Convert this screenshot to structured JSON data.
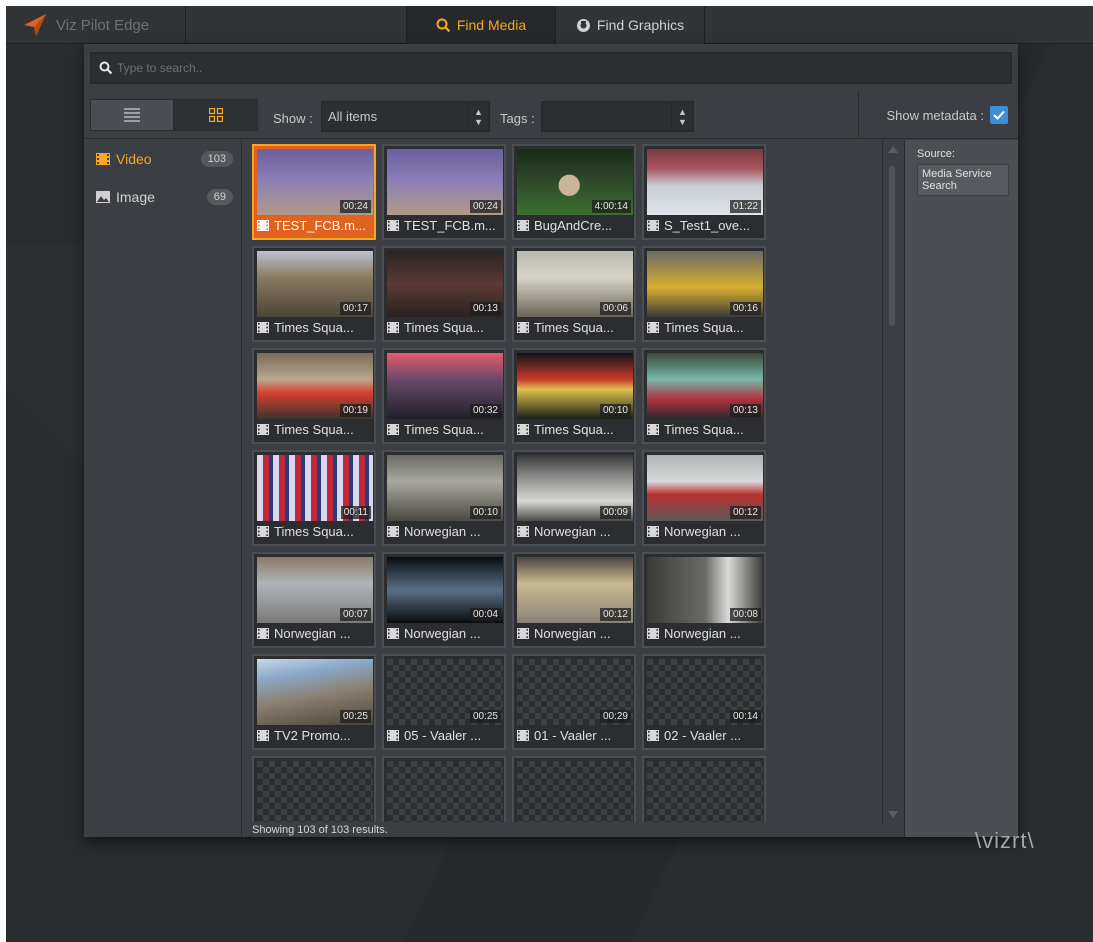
{
  "app": {
    "brand_name": "Viz Pilot Edge"
  },
  "tabs": [
    {
      "label": "Find Media",
      "active": true
    },
    {
      "label": "Find Graphics",
      "active": false
    }
  ],
  "search": {
    "placeholder": "Type to search.."
  },
  "toolbar": {
    "show_label": "Show :",
    "show_value": "All items",
    "tags_label": "Tags :",
    "tags_value": "",
    "show_metadata_label": "Show metadata :",
    "show_metadata_checked": true
  },
  "categories": [
    {
      "label": "Video",
      "count": "103",
      "active": true,
      "icon": "film-icon"
    },
    {
      "label": "Image",
      "count": "69",
      "active": false,
      "icon": "image-icon"
    }
  ],
  "items": [
    {
      "title": "TEST_FCB.m...",
      "duration": "00:24",
      "selected": true
    },
    {
      "title": "TEST_FCB.m...",
      "duration": "00:24"
    },
    {
      "title": "BugAndCre...",
      "duration": "4:00:14"
    },
    {
      "title": "S_Test1_ove...",
      "duration": "01:22"
    },
    {
      "title": "Times Squa...",
      "duration": "00:17"
    },
    {
      "title": "Times Squa...",
      "duration": "00:13"
    },
    {
      "title": "Times Squa...",
      "duration": "00:06"
    },
    {
      "title": "Times Squa...",
      "duration": "00:16"
    },
    {
      "title": "Times Squa...",
      "duration": "00:19"
    },
    {
      "title": "Times Squa...",
      "duration": "00:32"
    },
    {
      "title": "Times Squa...",
      "duration": "00:10"
    },
    {
      "title": "Times Squa...",
      "duration": "00:13"
    },
    {
      "title": "Times Squa...",
      "duration": "00:11"
    },
    {
      "title": "Norwegian ...",
      "duration": "00:10"
    },
    {
      "title": "Norwegian ...",
      "duration": "00:09"
    },
    {
      "title": "Norwegian ...",
      "duration": "00:12"
    },
    {
      "title": "Norwegian ...",
      "duration": "00:07"
    },
    {
      "title": "Norwegian ...",
      "duration": "00:04"
    },
    {
      "title": "Norwegian ...",
      "duration": "00:12"
    },
    {
      "title": "Norwegian ...",
      "duration": "00:08"
    },
    {
      "title": "TV2 Promo...",
      "duration": "00:25"
    },
    {
      "title": "05 - Vaaler ...",
      "duration": "00:25",
      "placeholder": true
    },
    {
      "title": "01 - Vaaler ...",
      "duration": "00:29",
      "placeholder": true
    },
    {
      "title": "02 - Vaaler ...",
      "duration": "00:14",
      "placeholder": true
    },
    {
      "title": "",
      "duration": "",
      "placeholder": true
    },
    {
      "title": "",
      "duration": "",
      "placeholder": true
    },
    {
      "title": "",
      "duration": "",
      "placeholder": true
    },
    {
      "title": "",
      "duration": "",
      "placeholder": true
    }
  ],
  "status": "Showing 103 of 103 results.",
  "source": {
    "label": "Source:",
    "value": "Media Service Search"
  },
  "footer_logo": "\\vizrt\\",
  "colors": {
    "accent": "#f5a623",
    "selected_tile": "#e0621f",
    "checkbox": "#3a8fd8"
  }
}
